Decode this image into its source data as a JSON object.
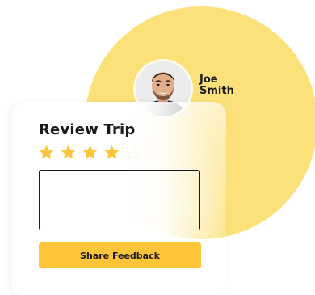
{
  "user": {
    "name": "Joe Smith"
  },
  "review": {
    "title": "Review Trip",
    "rating": 4,
    "max_rating": 5,
    "comment_value": "",
    "comment_placeholder": "",
    "submit_label": "Share Feedback"
  },
  "colors": {
    "accent_circle": "#fce17b",
    "star_filled": "#fec53b",
    "star_empty": "#ffffff",
    "button": "#fec53b"
  },
  "icons": {
    "star": "star-icon"
  }
}
